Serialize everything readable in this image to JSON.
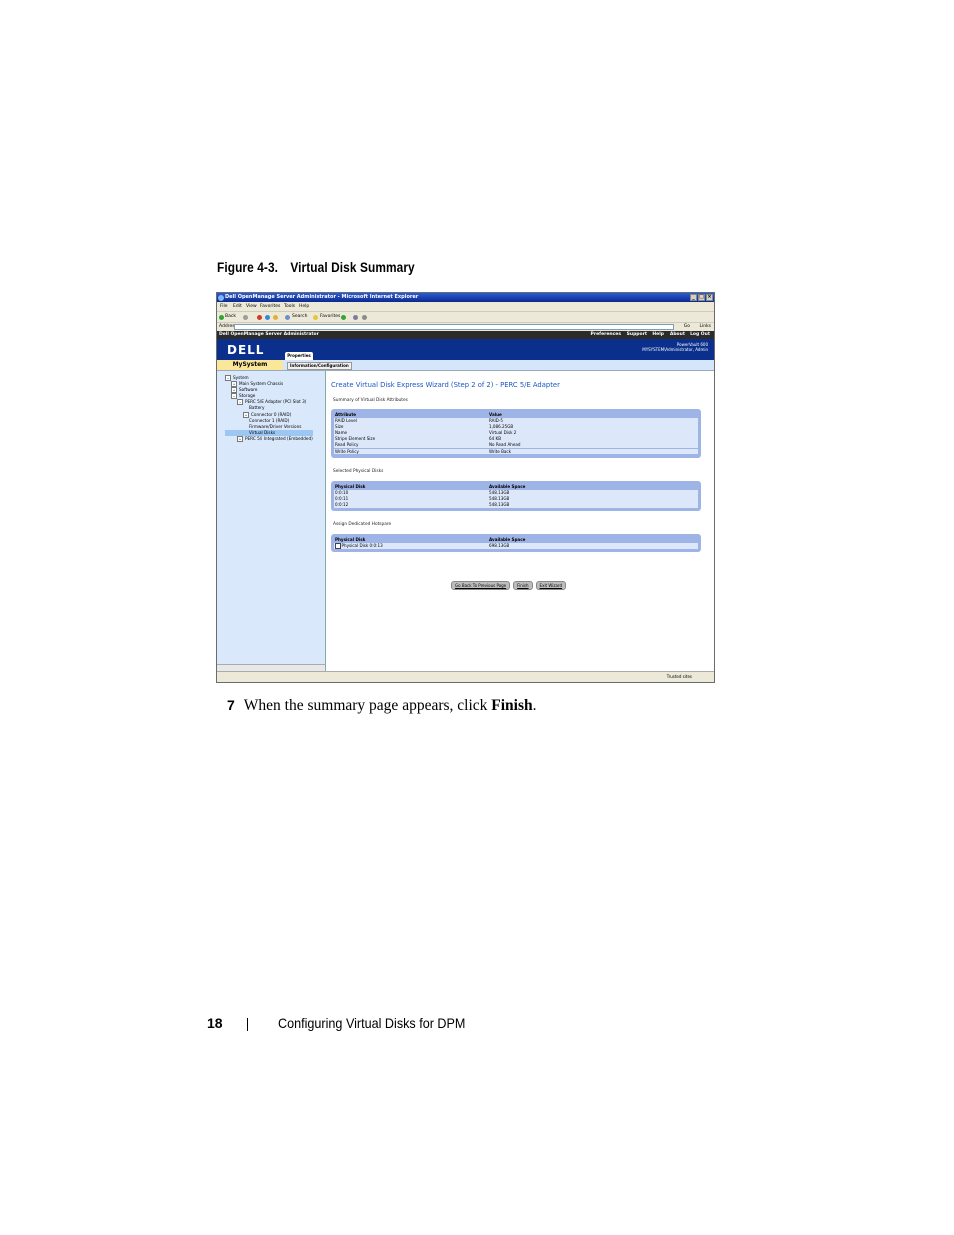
{
  "figure": {
    "number": "Figure 4-3.",
    "title": "Virtual Disk Summary"
  },
  "browser": {
    "window_title": "Dell OpenManage Server Administrator - Microsoft Internet Explorer",
    "menu": [
      "File",
      "Edit",
      "View",
      "Favorites",
      "Tools",
      "Help"
    ],
    "toolbar": {
      "back": "Back",
      "search": "Search",
      "favorites": "Favorites"
    },
    "address_label": "Address",
    "go_label": "Go",
    "links_label": "Links",
    "status_zone": "Trusted sites"
  },
  "omsa": {
    "app_title": "Dell OpenManage Server Administrator",
    "top_links": [
      "Preferences",
      "Support",
      "Help",
      "About",
      "Log Out"
    ],
    "logo": "DELL",
    "server_model": "PowerVault 600",
    "user_info": "MYSYSTEM\\Administrator, Admin",
    "tab_properties": "Properties",
    "mysystem": "MySystem",
    "subtab": "Information/Configuration"
  },
  "tree": [
    {
      "label": "System",
      "expander": "−"
    },
    {
      "label": "Main System Chassis",
      "expander": "+"
    },
    {
      "label": "Software",
      "expander": "+"
    },
    {
      "label": "Storage",
      "expander": "−"
    },
    {
      "label": "PERC 5/E Adapter (PCI Slot 3)",
      "expander": "−"
    },
    {
      "label": "Battery",
      "expander": ""
    },
    {
      "label": "Connector 0 (RAID)",
      "expander": "+"
    },
    {
      "label": "Connector 1 (RAID)",
      "expander": ""
    },
    {
      "label": "Firmware/Driver Versions",
      "expander": ""
    },
    {
      "label": "Virtual Disks",
      "expander": ""
    },
    {
      "label": "PERC 5/i Integrated (Embedded)",
      "expander": "+"
    }
  ],
  "wizard": {
    "title": "Create Virtual Disk Express Wizard (Step 2 of 2) - PERC 5/E Adapter",
    "summary_label": "Summary of Virtual Disk Attributes",
    "attr_headers": [
      "Attribute",
      "Value"
    ],
    "attributes": [
      [
        "RAID Level",
        "RAID-5"
      ],
      [
        "Size",
        "1,086.25GB"
      ],
      [
        "Name",
        "Virtual Disk 2"
      ],
      [
        "Stripe Element Size",
        "64 KB"
      ],
      [
        "Read Policy",
        "No Read Ahead"
      ],
      [
        "Write Policy",
        "Write Back"
      ]
    ],
    "selected_label": "Selected Physical Disks",
    "disk_headers": [
      "Physical Disk",
      "Available Space"
    ],
    "selected_disks": [
      [
        "0:0:10",
        "548.13GB"
      ],
      [
        "0:0:11",
        "548.13GB"
      ],
      [
        "0:0:12",
        "548.13GB"
      ]
    ],
    "hotspare_label": "Assign Dedicated Hotspare",
    "hotspare_headers": [
      "Physical Disk",
      "Available Space"
    ],
    "hotspare": [
      [
        "Physical Disk 0:0:13",
        "698.13GB"
      ]
    ],
    "buttons": {
      "back": "Go Back To Previous Page",
      "finish": "Finish",
      "exit": "Exit Wizard"
    }
  },
  "step": {
    "number": "7",
    "text": "When the summary page appears, click ",
    "bold": "Finish",
    "end": "."
  },
  "footer": {
    "page": "18",
    "text": "Configuring Virtual Disks for DPM"
  }
}
